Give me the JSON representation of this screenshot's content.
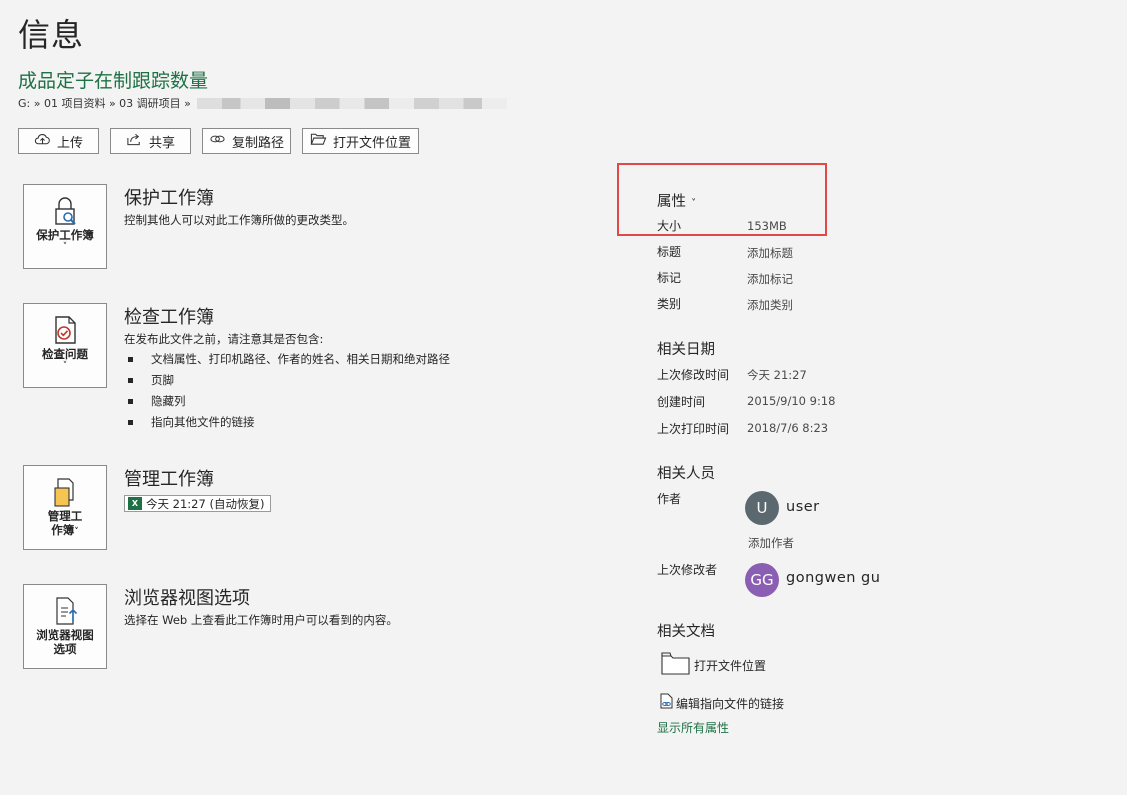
{
  "page_title": "信息",
  "document": {
    "title": "成品定子在制跟踪数量",
    "path": "G: » 01 项目资料 » 03 调研项目 »"
  },
  "toolbar": [
    {
      "label": "上传",
      "icon": "cloud-upload-icon"
    },
    {
      "label": "共享",
      "icon": "share-icon"
    },
    {
      "label": "复制路径",
      "icon": "link-icon"
    },
    {
      "label": "打开文件位置",
      "icon": "folder-open-icon"
    }
  ],
  "sections": {
    "protect": {
      "button_label": "保护工作簿",
      "title": "保护工作簿",
      "desc": "控制其他人可以对此工作簿所做的更改类型。",
      "icon": "lock-search-icon"
    },
    "inspect": {
      "button_label": "检查问题",
      "title": "检查工作簿",
      "desc": "在发布此文件之前，请注意其是否包含:",
      "bullets": [
        "文档属性、打印机路径、作者的姓名、相关日期和绝对路径",
        "页脚",
        "隐藏列",
        "指向其他文件的链接"
      ],
      "icon": "document-check-icon"
    },
    "manage": {
      "button_label_1": "管理工",
      "button_label_2": "作簿",
      "title": "管理工作簿",
      "autosave": "今天 21:27 (自动恢复)",
      "excel_badge": "X",
      "icon": "manage-workbook-icon"
    },
    "browser": {
      "button_label_1": "浏览器视图",
      "button_label_2": "选项",
      "title": "浏览器视图选项",
      "desc": "选择在 Web 上查看此工作簿时用户可以看到的内容。",
      "icon": "browser-view-icon"
    }
  },
  "properties": {
    "header": "属性",
    "chevron": "˅",
    "rows": [
      {
        "label": "大小",
        "value": "153MB"
      },
      {
        "label": "标题",
        "value": "添加标题"
      },
      {
        "label": "标记",
        "value": "添加标记"
      },
      {
        "label": "类别",
        "value": "添加类别"
      }
    ]
  },
  "related_dates": {
    "header": "相关日期",
    "rows": [
      {
        "label": "上次修改时间",
        "value": "今天 21:27"
      },
      {
        "label": "创建时间",
        "value": "2015/9/10 9:18"
      },
      {
        "label": "上次打印时间",
        "value": "2018/7/6 8:23"
      }
    ]
  },
  "related_people": {
    "header": "相关人员",
    "author_label": "作者",
    "author": {
      "initials": "U",
      "name": "user",
      "color": "#5c6870"
    },
    "add_author": "添加作者",
    "modifier_label": "上次修改者",
    "modifier": {
      "initials": "GG",
      "name": "gongwen gu",
      "color": "#8a5fb3"
    }
  },
  "related_docs": {
    "header": "相关文档",
    "open_location": "打开文件位置",
    "edit_links": "编辑指向文件的链接",
    "show_all": "显示所有属性"
  },
  "colors": {
    "accent_green": "#1e7145",
    "highlight_red": "#e24848",
    "background": "#f3f3f3"
  }
}
